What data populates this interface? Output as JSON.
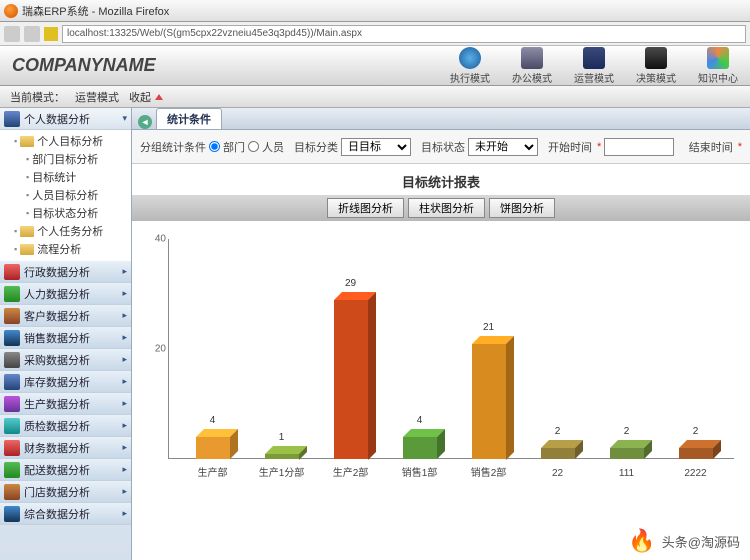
{
  "window": {
    "title": "瑞森ERP系统 - Mozilla Firefox"
  },
  "address": {
    "url": "localhost:13325/Web/(S(gm5cpx22vzneiu45e3q3pd45))/Main.aspx"
  },
  "brand": "COMPANYNAME",
  "topnav": [
    {
      "label": "执行模式"
    },
    {
      "label": "办公模式"
    },
    {
      "label": "运营模式"
    },
    {
      "label": "决策模式"
    },
    {
      "label": "知识中心"
    }
  ],
  "status": {
    "mode_label": "当前模式：",
    "mode_value": "运营模式",
    "collapse": "收起"
  },
  "sidebar": {
    "top": {
      "label": "个人数据分析"
    },
    "tree_root": "个人目标分析",
    "tree_children": [
      "部门目标分析",
      "目标统计",
      "人员目标分析",
      "目标状态分析"
    ],
    "tree_siblings": [
      "个人任务分析",
      "流程分析"
    ],
    "modules": [
      "行政数据分析",
      "人力数据分析",
      "客户数据分析",
      "销售数据分析",
      "采购数据分析",
      "库存数据分析",
      "生产数据分析",
      "质检数据分析",
      "财务数据分析",
      "配送数据分析",
      "门店数据分析",
      "综合数据分析"
    ]
  },
  "tab": {
    "title": "统计条件"
  },
  "filter": {
    "group_label": "分组统计条件",
    "opt_dept": "部门",
    "opt_person": "人员",
    "cat_label": "目标分类",
    "cat_value": "日目标",
    "state_label": "目标状态",
    "state_value": "未开始",
    "start_label": "开始时间",
    "end_label": "结束时间"
  },
  "chart_title": "目标统计报表",
  "chart_tabs": [
    "折线图分析",
    "柱状图分析",
    "饼图分析"
  ],
  "chart_data": {
    "type": "bar",
    "title": "目标统计报表",
    "xlabel": "",
    "ylabel": "",
    "ylim": [
      0,
      40
    ],
    "yticks": [
      40,
      20
    ],
    "categories": [
      "生产部",
      "生产1分部",
      "生产2部",
      "销售1部",
      "销售2部",
      "22",
      "111",
      "2222"
    ],
    "values": [
      4,
      1,
      29,
      4,
      21,
      2,
      2,
      2
    ],
    "colors": [
      "#e89a2e",
      "#7d9a3a",
      "#cf4a1a",
      "#5a9a3a",
      "#d88b1e",
      "#927f3a",
      "#6f8f3f",
      "#a55a25"
    ]
  },
  "watermark": "头条@淘源码"
}
